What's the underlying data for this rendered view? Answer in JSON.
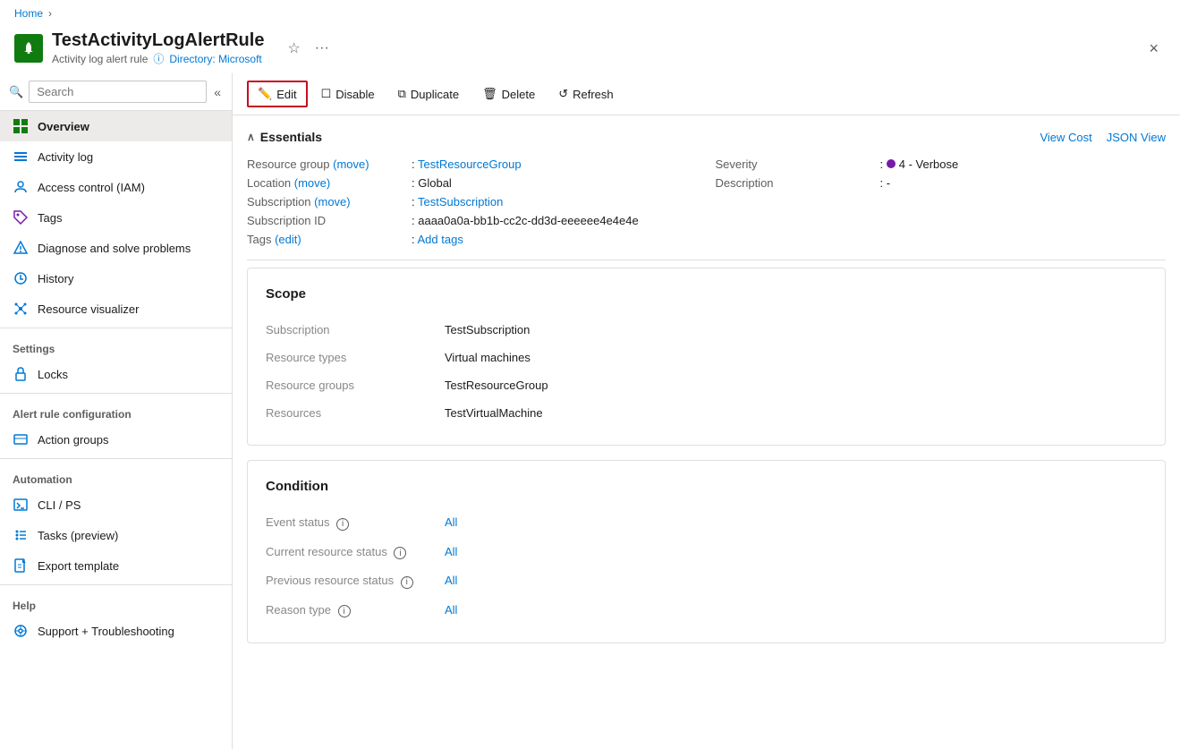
{
  "breadcrumb": {
    "home_label": "Home",
    "separator": "›"
  },
  "page": {
    "icon_char": "🔔",
    "title": "TestActivityLogAlertRule",
    "subtitle_type": "Activity log alert rule",
    "info_label": "Directory: Microsoft",
    "close_label": "×"
  },
  "toolbar": {
    "edit_label": "Edit",
    "disable_label": "Disable",
    "duplicate_label": "Duplicate",
    "delete_label": "Delete",
    "refresh_label": "Refresh"
  },
  "sidebar": {
    "search_placeholder": "Search",
    "items": [
      {
        "id": "overview",
        "label": "Overview",
        "active": true
      },
      {
        "id": "activity-log",
        "label": "Activity log",
        "active": false
      },
      {
        "id": "access-control",
        "label": "Access control (IAM)",
        "active": false
      },
      {
        "id": "tags",
        "label": "Tags",
        "active": false
      },
      {
        "id": "diagnose",
        "label": "Diagnose and solve problems",
        "active": false
      },
      {
        "id": "history",
        "label": "History",
        "active": false
      },
      {
        "id": "resource-visualizer",
        "label": "Resource visualizer",
        "active": false
      }
    ],
    "sections": [
      {
        "label": "Settings",
        "items": [
          {
            "id": "locks",
            "label": "Locks"
          }
        ]
      },
      {
        "label": "Alert rule configuration",
        "items": [
          {
            "id": "action-groups",
            "label": "Action groups"
          }
        ]
      },
      {
        "label": "Automation",
        "items": [
          {
            "id": "cli-ps",
            "label": "CLI / PS"
          },
          {
            "id": "tasks",
            "label": "Tasks (preview)"
          },
          {
            "id": "export-template",
            "label": "Export template"
          }
        ]
      },
      {
        "label": "Help",
        "items": [
          {
            "id": "support",
            "label": "Support + Troubleshooting"
          }
        ]
      }
    ]
  },
  "essentials": {
    "title": "Essentials",
    "view_cost_label": "View Cost",
    "json_view_label": "JSON View",
    "fields": {
      "resource_group_label": "Resource group (move)",
      "resource_group_value": "TestResourceGroup",
      "severity_label": "Severity",
      "severity_value": "4 - Verbose",
      "location_label": "Location (move)",
      "location_value": "Global",
      "description_label": "Description",
      "description_value": "-",
      "subscription_label": "Subscription (move)",
      "subscription_value": "TestSubscription",
      "subscription_id_label": "Subscription ID",
      "subscription_id_value": "aaaa0a0a-bb1b-cc2c-dd3d-eeeeee4e4e4e",
      "tags_label": "Tags (edit)",
      "tags_value": "Add tags"
    }
  },
  "scope": {
    "title": "Scope",
    "subscription_label": "Subscription",
    "subscription_value": "TestSubscription",
    "resource_types_label": "Resource types",
    "resource_types_value": "Virtual machines",
    "resource_groups_label": "Resource groups",
    "resource_groups_value": "TestResourceGroup",
    "resources_label": "Resources",
    "resources_value": "TestVirtualMachine"
  },
  "condition": {
    "title": "Condition",
    "event_status_label": "Event status",
    "event_status_value": "All",
    "current_resource_status_label": "Current resource status",
    "current_resource_status_value": "All",
    "previous_resource_status_label": "Previous resource status",
    "previous_resource_status_value": "All",
    "reason_type_label": "Reason type",
    "reason_type_value": "All"
  }
}
